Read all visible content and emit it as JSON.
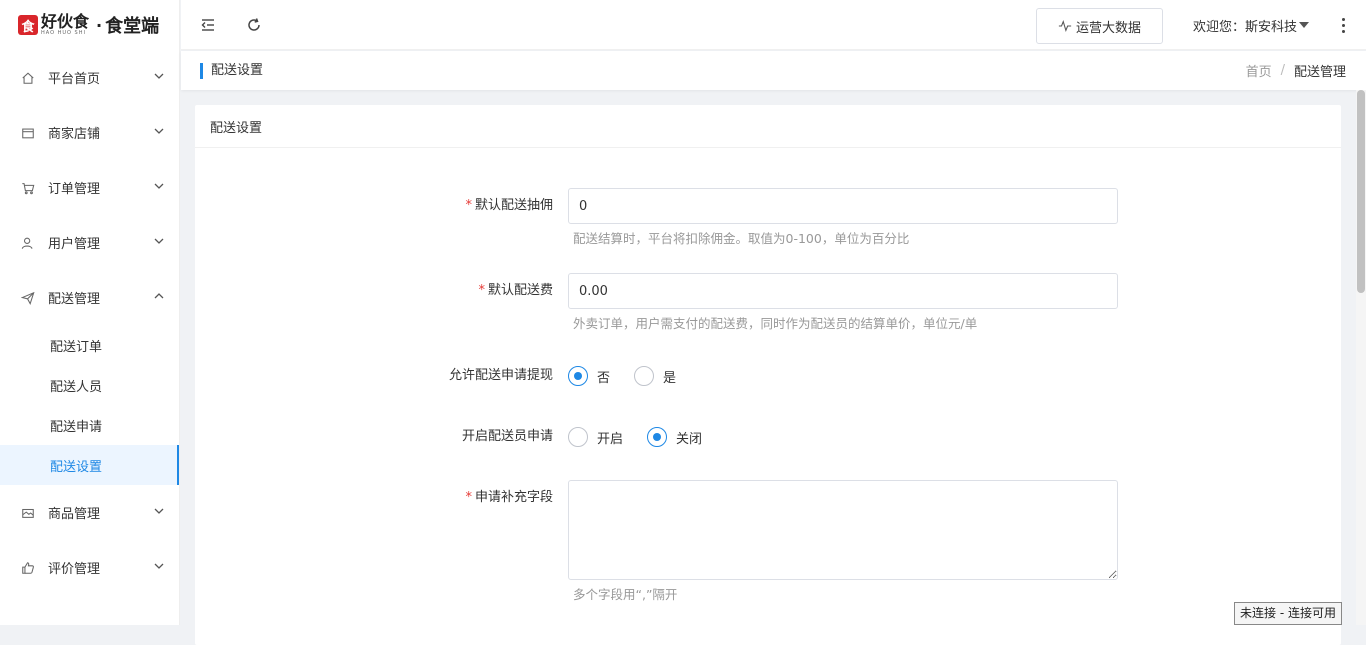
{
  "brand": {
    "mark": "食",
    "name": "好伙食",
    "pinyin": "HAO HUO SHI",
    "dot": "·",
    "suffix": "食堂端",
    "color": "#d9262b"
  },
  "sidebar": {
    "items": [
      {
        "label": "平台首页",
        "icon": "home-icon",
        "expanded": false
      },
      {
        "label": "商家店铺",
        "icon": "store-icon",
        "expanded": false
      },
      {
        "label": "订单管理",
        "icon": "cart-icon",
        "expanded": false
      },
      {
        "label": "用户管理",
        "icon": "user-icon",
        "expanded": false
      },
      {
        "label": "配送管理",
        "icon": "send-icon",
        "expanded": true,
        "children": [
          {
            "label": "配送订单"
          },
          {
            "label": "配送人员"
          },
          {
            "label": "配送申请"
          },
          {
            "label": "配送设置",
            "active": true
          }
        ]
      },
      {
        "label": "商品管理",
        "icon": "goods-icon",
        "expanded": false
      },
      {
        "label": "评价管理",
        "icon": "thumb-icon",
        "expanded": false
      }
    ]
  },
  "header": {
    "data_button": "运营大数据",
    "welcome": "欢迎您：斯安科技"
  },
  "crumbbar": {
    "title": "配送设置",
    "breadcrumb": [
      "首页",
      "/",
      "配送管理"
    ]
  },
  "card": {
    "title": "配送设置"
  },
  "form": {
    "commission": {
      "label": "默认配送抽佣",
      "value": "0",
      "hint": "配送结算时，平台将扣除佣金。取值为0-100，单位为百分比"
    },
    "fee": {
      "label": "默认配送费",
      "value": "0.00",
      "hint": "外卖订单，用户需支付的配送费，同时作为配送员的结算单价，单位元/单"
    },
    "withdraw": {
      "label": "允许配送申请提现",
      "options": [
        "否",
        "是"
      ],
      "selected": "否"
    },
    "apply": {
      "label": "开启配送员申请",
      "options": [
        "开启",
        "关闭"
      ],
      "selected": "关闭"
    },
    "extra": {
      "label": "申请补充字段",
      "value": "",
      "hint": "多个字段用“,”隔开"
    }
  },
  "status_tip": "未连接 - 连接可用",
  "colors": {
    "accent": "#1e88e5",
    "required": "#e53935"
  }
}
